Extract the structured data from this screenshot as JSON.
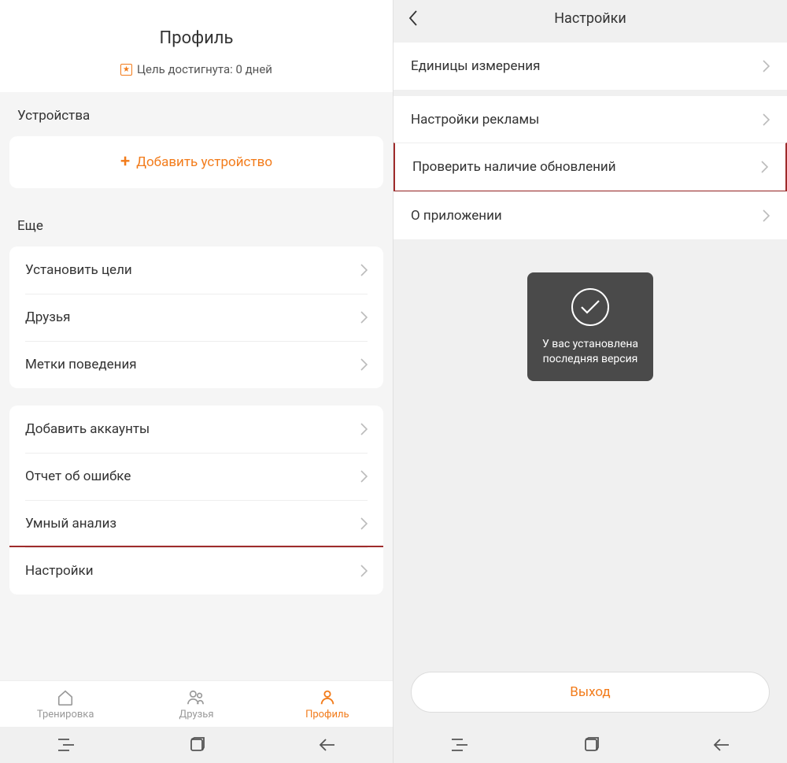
{
  "left": {
    "title": "Профиль",
    "goal_text": "Цель достигнута: 0 дней",
    "devices_label": "Устройства",
    "add_device": "Добавить устройство",
    "more_label": "Еще",
    "group1": {
      "goals": "Установить цели",
      "friends": "Друзья",
      "behavior": "Метки поведения"
    },
    "group2": {
      "accounts": "Добавить аккаунты",
      "bug": "Отчет об ошибке",
      "analysis": "Умный анализ",
      "settings": "Настройки"
    },
    "tabs": {
      "workout": "Тренировка",
      "friends": "Друзья",
      "profile": "Профиль"
    }
  },
  "right": {
    "title": "Настройки",
    "items": {
      "units": "Единицы измерения",
      "ads": "Настройки рекламы",
      "updates": "Проверить наличие обновлений",
      "about": "О приложении"
    },
    "toast": "У вас установлена последняя версия",
    "logout": "Выход"
  }
}
